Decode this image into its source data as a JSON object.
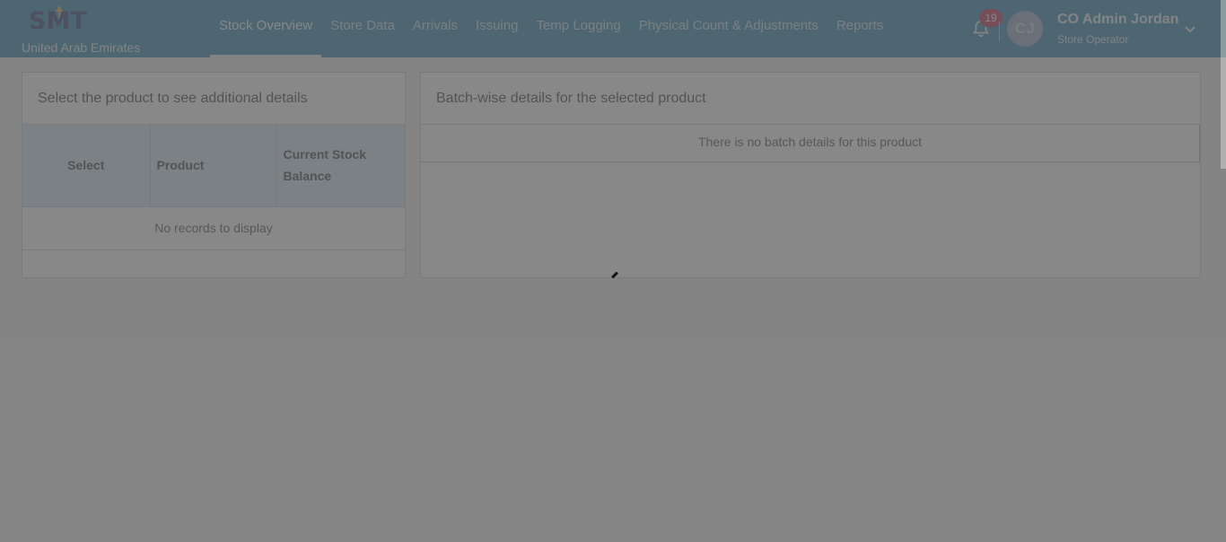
{
  "app": {
    "logo_text": "SMT",
    "country": "United Arab Emirates"
  },
  "nav": {
    "items": [
      {
        "label": "Stock Overview",
        "active": true
      },
      {
        "label": "Store Data",
        "active": false
      },
      {
        "label": "Arrivals",
        "active": false
      },
      {
        "label": "Issuing",
        "active": false
      },
      {
        "label": "Temp Logging",
        "active": false
      },
      {
        "label": "Physical Count & Adjustments",
        "active": false
      },
      {
        "label": "Reports",
        "active": false
      }
    ]
  },
  "notifications": {
    "count": "19",
    "icon": "bell-icon"
  },
  "user": {
    "initials": "CJ",
    "name": "CO Admin Jordan",
    "role": "Store Operator",
    "menu_icon": "chevron-down-icon"
  },
  "product_panel": {
    "title": "Select the product to see additional details",
    "columns": [
      "Select",
      "Product",
      "Current Stock Balance"
    ],
    "empty_text": "No records to display"
  },
  "batch_panel": {
    "title": "Batch-wise details for the selected product",
    "empty_text": "There is no batch details for this product"
  },
  "colors": {
    "header": "#1f7ca8",
    "table_header": "#cfe3f1",
    "badge": "#b5224d",
    "overlay": "rgba(95,95,95,0.74)"
  }
}
